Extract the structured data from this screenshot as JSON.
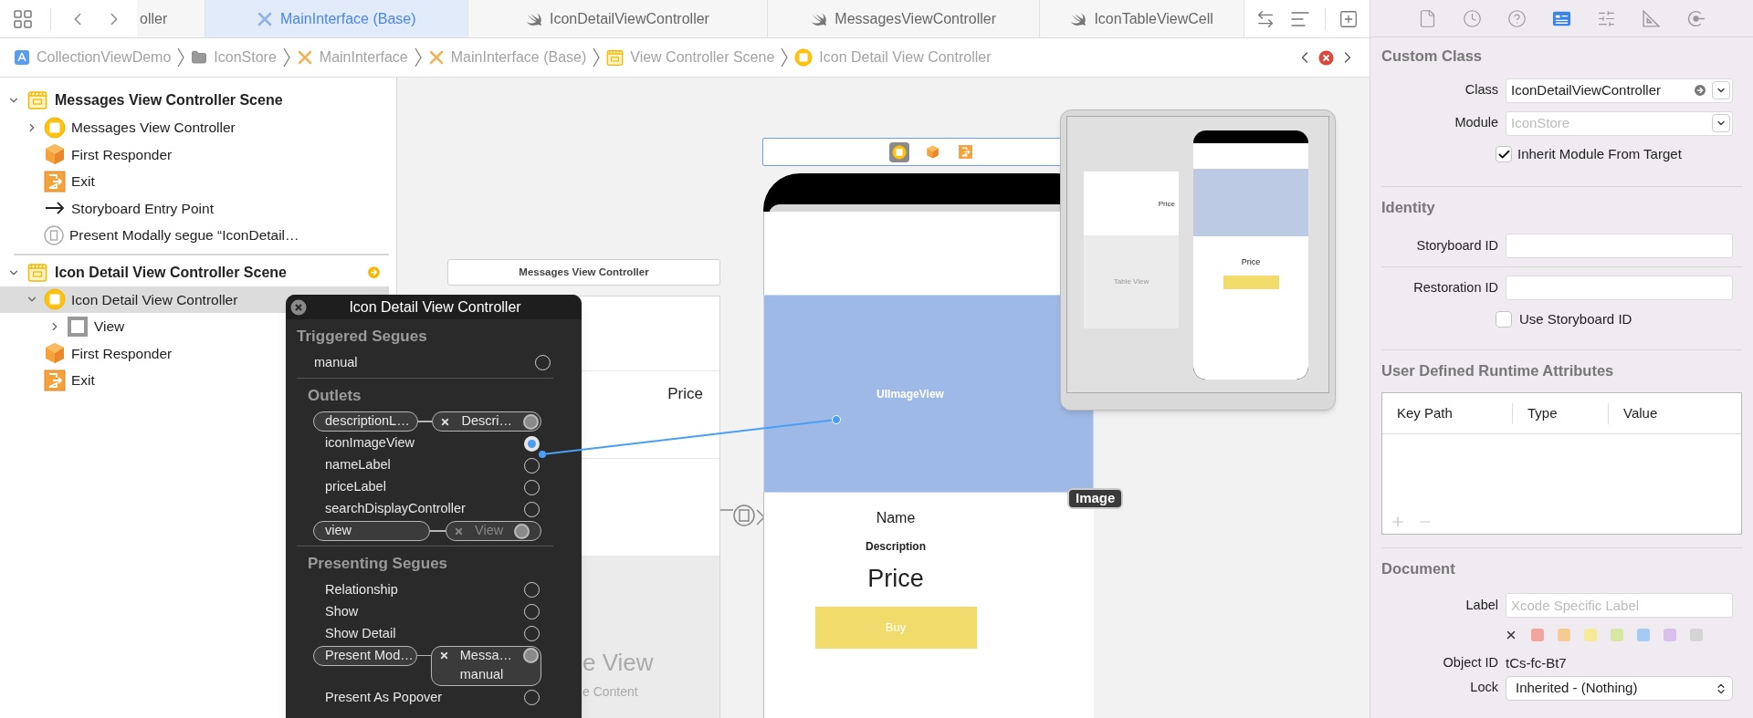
{
  "tab_bar": {
    "tabs": [
      {
        "label": "oller",
        "kind": "partial",
        "selected": false
      },
      {
        "label": "MainInterface (Base)",
        "kind": "storyboard",
        "selected": true
      },
      {
        "label": "IconDetailViewController",
        "kind": "swift",
        "selected": false
      },
      {
        "label": "MessagesViewController",
        "kind": "swift",
        "selected": false
      },
      {
        "label": "IconTableViewCell",
        "kind": "swift",
        "selected": false
      }
    ]
  },
  "breadcrumb": {
    "items": [
      {
        "label": "CollectionViewDemo",
        "kind": "project"
      },
      {
        "label": "IconStore",
        "kind": "folder"
      },
      {
        "label": "MainInterface",
        "kind": "storyboard"
      },
      {
        "label": "MainInterface (Base)",
        "kind": "storyboard"
      },
      {
        "label": "View Controller Scene",
        "kind": "scene"
      },
      {
        "label": "Icon Detail View Controller",
        "kind": "controller"
      }
    ],
    "has_error": true
  },
  "outline": {
    "scenes": [
      {
        "title": "Messages View Controller Scene",
        "expanded": true,
        "segue_badge": false,
        "items": [
          {
            "label": "Messages View Controller",
            "kind": "controller",
            "expanded": false,
            "selected": false
          },
          {
            "label": "First Responder",
            "kind": "responder",
            "selected": false
          },
          {
            "label": "Exit",
            "kind": "exit",
            "selected": false
          },
          {
            "label": "Storyboard Entry Point",
            "kind": "entry",
            "selected": false
          },
          {
            "label": "Present Modally segue “IconDetail…",
            "kind": "segue",
            "selected": false
          }
        ]
      },
      {
        "title": "Icon Detail View Controller Scene",
        "expanded": true,
        "segue_badge": true,
        "items": [
          {
            "label": "Icon Detail View Controller",
            "kind": "controller",
            "expanded": true,
            "selected": true,
            "children": [
              {
                "label": "View",
                "kind": "view",
                "expanded": false,
                "selected": false
              }
            ]
          },
          {
            "label": "First Responder",
            "kind": "responder",
            "selected": false
          },
          {
            "label": "Exit",
            "kind": "exit",
            "selected": false
          }
        ]
      }
    ]
  },
  "connections_popup": {
    "title": "Icon Detail View Controller",
    "sections": [
      {
        "title": "Triggered Segues",
        "rows": [
          {
            "label": "manual",
            "kind": "open"
          }
        ]
      },
      {
        "title": "Outlets",
        "rows": [
          {
            "label": "descriptionL…",
            "kind": "linked",
            "target": "Descri…",
            "dimmed": false
          },
          {
            "label": "iconImageView",
            "kind": "dragging"
          },
          {
            "label": "nameLabel",
            "kind": "open"
          },
          {
            "label": "priceLabel",
            "kind": "open"
          },
          {
            "label": "searchDisplayController",
            "kind": "open"
          },
          {
            "label": "view",
            "kind": "linked",
            "target": "View",
            "dimmed": true
          }
        ]
      },
      {
        "title": "Presenting Segues",
        "rows": [
          {
            "label": "Relationship",
            "kind": "open"
          },
          {
            "label": "Show",
            "kind": "open"
          },
          {
            "label": "Show Detail",
            "kind": "open"
          },
          {
            "label": "Present Mod…",
            "kind": "linked",
            "target": "Messa…",
            "target_detail": "manual",
            "dimmed": false
          },
          {
            "label": "Present As Popover",
            "kind": "open"
          }
        ]
      }
    ]
  },
  "canvas": {
    "messages_scene": {
      "title": "Messages View Controller",
      "price": "Price",
      "table_title": "e View",
      "table_subtitle": "e Content"
    },
    "dock": [
      {
        "kind": "controller",
        "selected": true
      },
      {
        "kind": "responder",
        "selected": false
      },
      {
        "kind": "exit",
        "selected": false
      }
    ],
    "detail_scene": {
      "image_placeholder": "UIImageView",
      "badge": "Image",
      "name": "Name",
      "description": "Description",
      "price": "Price",
      "button": "Buy"
    },
    "minimap": {
      "table_title": "Table View",
      "cell_price": "Price",
      "phone_price": "Price"
    }
  },
  "inspector": {
    "tabs": [
      {
        "kind": "file",
        "selected": false
      },
      {
        "kind": "history",
        "selected": false
      },
      {
        "kind": "help",
        "selected": false
      },
      {
        "kind": "identity",
        "selected": true
      },
      {
        "kind": "attributes",
        "selected": false
      },
      {
        "kind": "size",
        "selected": false
      },
      {
        "kind": "connections",
        "selected": false
      }
    ],
    "custom_class": {
      "heading": "Custom Class",
      "class_label": "Class",
      "class_value": "IconDetailViewController",
      "module_label": "Module",
      "module_placeholder": "IconStore",
      "inherit": {
        "label": "Inherit Module From Target",
        "checked": true
      }
    },
    "identity": {
      "heading": "Identity",
      "storyboard_id_label": "Storyboard ID",
      "restoration_id_label": "Restoration ID",
      "use_storyboard_id": {
        "label": "Use Storyboard ID",
        "checked": false
      }
    },
    "runtime_attributes": {
      "heading": "User Defined Runtime Attributes",
      "columns": [
        "Key Path",
        "Type",
        "Value"
      ]
    },
    "document": {
      "heading": "Document",
      "label_label": "Label",
      "label_placeholder": "Xcode Specific Label",
      "label_colors": [
        {
          "color": "#f2a59e"
        },
        {
          "color": "#f6cb92"
        },
        {
          "color": "#f7ea94"
        },
        {
          "color": "#d7e7a2"
        },
        {
          "color": "#a3c9f4"
        },
        {
          "color": "#d8c0ea"
        },
        {
          "color": "#d5d5d5"
        }
      ],
      "object_id_label": "Object ID",
      "object_id": "tCs-fc-Bt7",
      "lock_label": "Lock",
      "lock_value": "Inherited - (Nothing)"
    }
  }
}
